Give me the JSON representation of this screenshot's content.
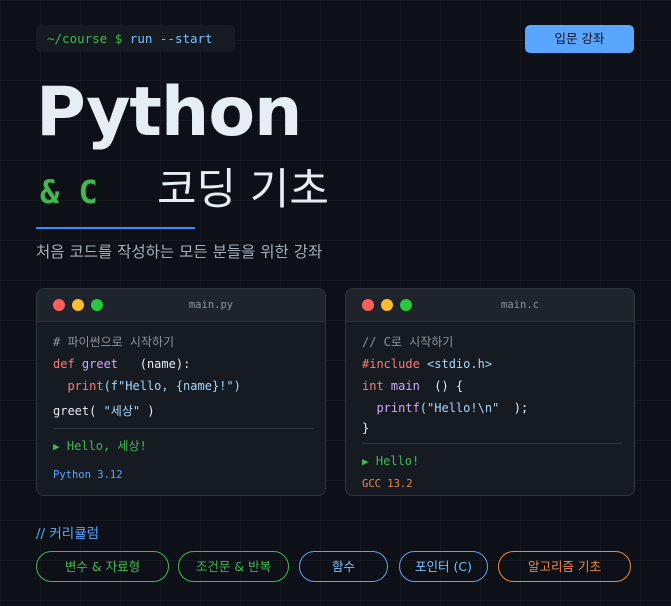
{
  "header": {
    "terminal_prompt": "~/course $",
    "terminal_command": " run --start",
    "badge": "입문 강좌"
  },
  "hero": {
    "title": "Python",
    "amp_c": "& C",
    "subtitle_title": "코딩 기초",
    "tagline": "처음 코드를 작성하는 모든 분들을 위한 강좌"
  },
  "cards": {
    "python": {
      "filename": "main.py",
      "comment": "# 파이썬으로 시작하기",
      "def_kw": "def",
      "def_name": " greet",
      "def_params": "   (name):",
      "print_fn": "  print",
      "print_arg": "(f\"Hello, {name}!\")",
      "call_fn": "greet(",
      "call_arg": " \"세상\"",
      "call_end": " )",
      "output_marker": "▶",
      "output": " Hello, 세상!",
      "version": "Python 3.12"
    },
    "c": {
      "filename": "main.c",
      "comment": "// C로 시작하기",
      "include_kw": "#include",
      "include_hdr": " <stdio.h>",
      "int_kw": "int",
      "main_name": " main",
      "main_sig": "  () {",
      "printf_fn": "  printf",
      "printf_arg": "(\"Hello!\\n\"",
      "printf_end": "  );",
      "close": "}",
      "output_marker": "▶",
      "output": " Hello!",
      "version": "GCC 13.2"
    }
  },
  "curriculum": {
    "label": "// 커리큘럼",
    "items": [
      "변수 & 자료형",
      "조건문 & 반복",
      "함수",
      "포인터 (C)",
      "알고리즘 기초"
    ]
  },
  "colors": {
    "background": "#0d1117",
    "green": "#3fb950",
    "blue": "#58a6ff",
    "orange": "#f0883e"
  }
}
